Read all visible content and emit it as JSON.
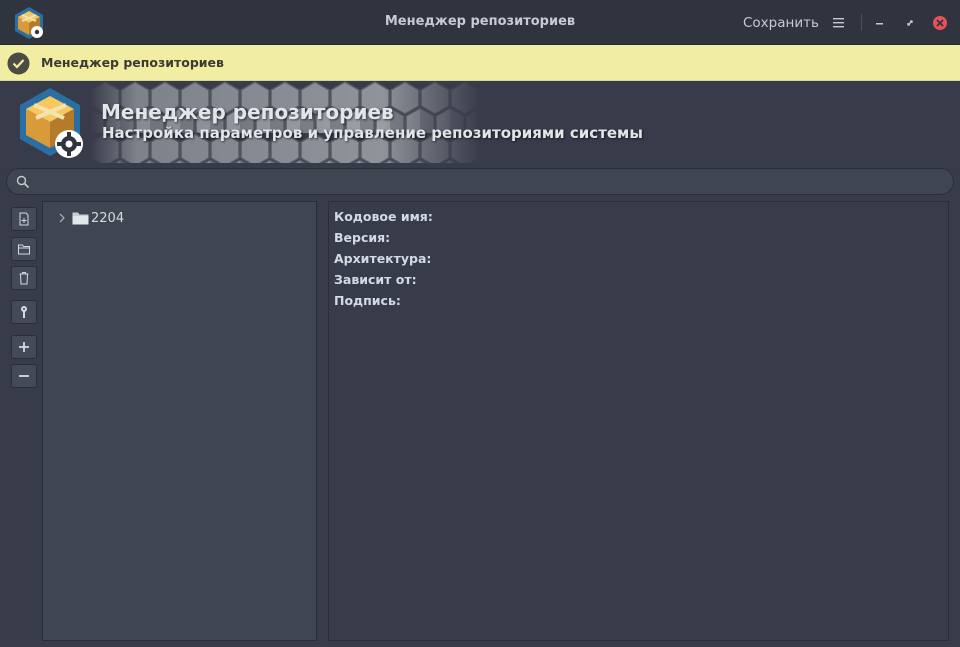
{
  "window": {
    "title": "Менеджер репозиториев",
    "save_label": "Сохранить"
  },
  "infobar": {
    "message": "Менеджер репозиториев"
  },
  "banner": {
    "title": "Менеджер репозиториев",
    "subtitle": "Настройка параметров и управление репозиториями системы"
  },
  "search": {
    "value": "",
    "placeholder": ""
  },
  "toolbar": {
    "icons": [
      "new-file-icon",
      "folder-icon",
      "trash-icon",
      "key-icon",
      "plus-icon",
      "minus-icon"
    ]
  },
  "tree": {
    "items": [
      {
        "label": "2204",
        "expanded": false
      }
    ]
  },
  "details": {
    "codename_label": "Кодовое имя:",
    "version_label": "Версия:",
    "architecture_label": "Архитектура:",
    "depends_label": "Зависит от:",
    "signature_label": "Подпись:"
  },
  "colors": {
    "window_bg": "#383c4a",
    "titlebar_bg": "#2f343f",
    "panel_bg": "#404552",
    "infobar_bg": "#f1eea4",
    "close_red": "#e9505a",
    "text": "#d3dae3"
  }
}
